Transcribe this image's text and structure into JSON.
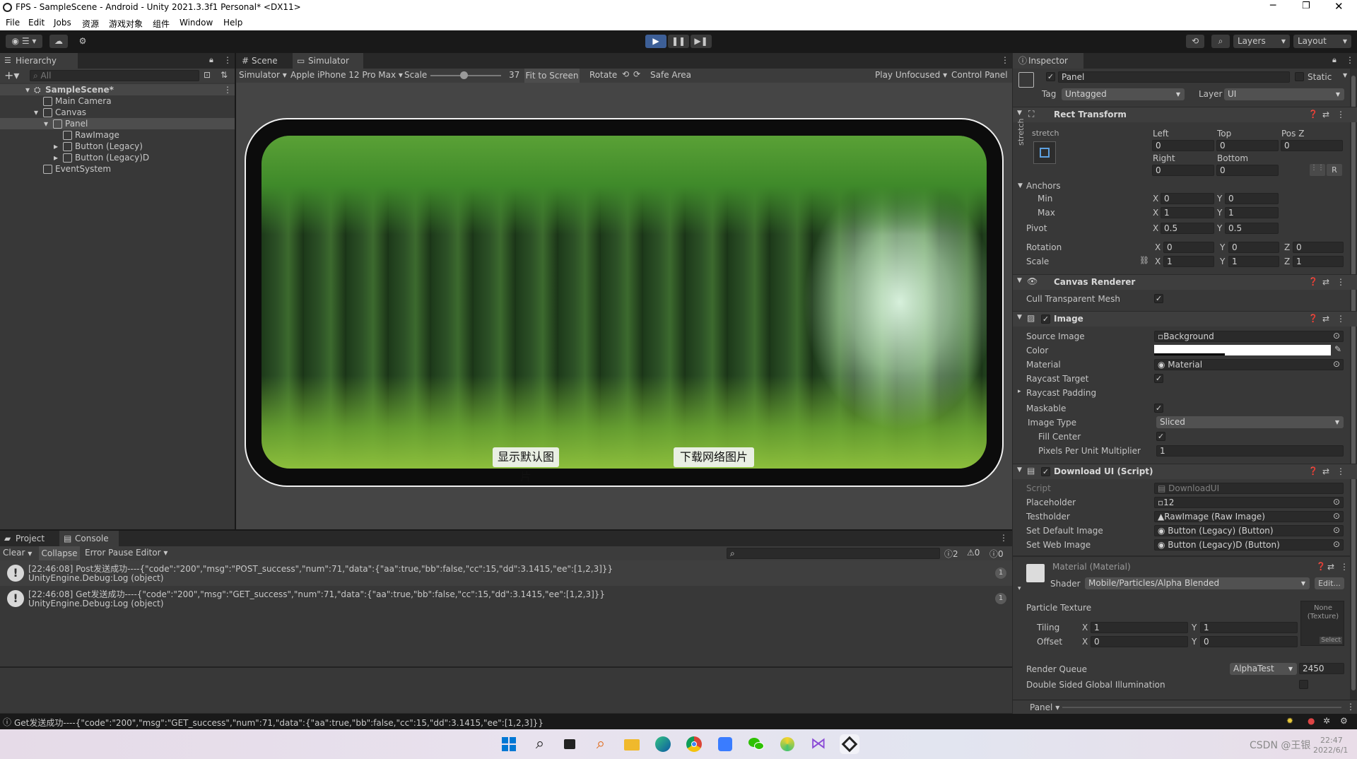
{
  "window": {
    "title": "FPS - SampleScene - Android - Unity 2021.3.3f1 Personal* <DX11>"
  },
  "menu": [
    "File",
    "Edit",
    "Jobs",
    "资源",
    "游戏对象",
    "组件",
    "Window",
    "Help"
  ],
  "toolbar": {
    "layers": "Layers",
    "layout": "Layout"
  },
  "hierarchy": {
    "tab": "Hierarchy",
    "search_placeholder": "All",
    "items": [
      {
        "label": "SampleScene*",
        "depth": 0
      },
      {
        "label": "Main Camera",
        "depth": 1
      },
      {
        "label": "Canvas",
        "depth": 1
      },
      {
        "label": "Panel",
        "depth": 2
      },
      {
        "label": "RawImage",
        "depth": 3
      },
      {
        "label": "Button (Legacy)",
        "depth": 3
      },
      {
        "label": "Button (Legacy)D",
        "depth": 3
      },
      {
        "label": "EventSystem",
        "depth": 1
      }
    ]
  },
  "scene_tabs": {
    "scene": "Scene",
    "simulator": "Simulator"
  },
  "sim_toolbar": {
    "mode": "Simulator",
    "device": "Apple iPhone 12 Pro Max",
    "scale_label": "Scale",
    "scale_value": "37",
    "fit": "Fit to Screen",
    "rotate": "Rotate",
    "safe_area": "Safe Area",
    "play_mode": "Play Unfocused",
    "control_panel": "Control Panel"
  },
  "game": {
    "button_default": "显示默认图片",
    "button_web": "下载网络图片"
  },
  "bottom_tabs": {
    "project": "Project",
    "console": "Console"
  },
  "console_toolbar": {
    "clear": "Clear",
    "collapse": "Collapse",
    "error_pause": "Error Pause",
    "editor": "Editor",
    "count_info": "2",
    "count_warn": "0",
    "count_err": "0"
  },
  "console_entries": [
    {
      "line1": "[22:46:08] Post发送成功----{\"code\":\"200\",\"msg\":\"POST_success\",\"num\":71,\"data\":{\"aa\":true,\"bb\":false,\"cc\":15,\"dd\":3.1415,\"ee\":[1,2,3]}}",
      "line2": "UnityEngine.Debug:Log (object)",
      "count": "1"
    },
    {
      "line1": "[22:46:08] Get发送成功----{\"code\":\"200\",\"msg\":\"GET_success\",\"num\":71,\"data\":{\"aa\":true,\"bb\":false,\"cc\":15,\"dd\":3.1415,\"ee\":[1,2,3]}}",
      "line2": "UnityEngine.Debug:Log (object)",
      "count": "1"
    }
  ],
  "status_bar": "Get发送成功----{\"code\":\"200\",\"msg\":\"GET_success\",\"num\":71,\"data\":{\"aa\":true,\"bb\":false,\"cc\":15,\"dd\":3.1415,\"ee\":[1,2,3]}}",
  "inspector": {
    "tab": "Inspector",
    "object_name": "Panel",
    "static": "Static",
    "tag_label": "Tag",
    "tag": "Untagged",
    "layer_label": "Layer",
    "layer": "UI",
    "rect": {
      "title": "Rect Transform",
      "stretch_top": "stretch",
      "stretch_side": "stretch",
      "left_lbl": "Left",
      "top_lbl": "Top",
      "posz_lbl": "Pos Z",
      "left": "0",
      "top": "0",
      "posz": "0",
      "right_lbl": "Right",
      "bottom_lbl": "Bottom",
      "right": "0",
      "bottom": "0",
      "r_btn": "R",
      "anchors": "Anchors",
      "min": "Min",
      "max": "Max",
      "pivot": "Pivot",
      "rotation": "Rotation",
      "scale": "Scale",
      "x": "X",
      "y": "Y",
      "z": "Z",
      "min_x": "0",
      "min_y": "0",
      "max_x": "1",
      "max_y": "1",
      "pivot_x": "0.5",
      "pivot_y": "0.5",
      "rot_x": "0",
      "rot_y": "0",
      "rot_z": "0",
      "scale_x": "1",
      "scale_y": "1",
      "scale_z": "1"
    },
    "canvas_renderer": {
      "title": "Canvas Renderer",
      "cull": "Cull Transparent Mesh"
    },
    "image": {
      "title": "Image",
      "source_lbl": "Source Image",
      "source": "Background",
      "color_lbl": "Color",
      "material_lbl": "Material",
      "material": "Material",
      "raycast_lbl": "Raycast Target",
      "padding_lbl": "Raycast Padding",
      "maskable_lbl": "Maskable",
      "type_lbl": "Image Type",
      "type": "Sliced",
      "fill_lbl": "Fill Center",
      "ppu_lbl": "Pixels Per Unit Multiplier",
      "ppu": "1"
    },
    "download": {
      "title": "Download UI (Script)",
      "script_lbl": "Script",
      "script": "DownloadUI",
      "placeholder_lbl": "Placeholder",
      "placeholder": "12",
      "testholder_lbl": "Testholder",
      "testholder": "RawImage (Raw Image)",
      "setdefault_lbl": "Set Default Image",
      "setdefault": "Button (Legacy) (Button)",
      "setweb_lbl": "Set Web Image",
      "setweb": "Button (Legacy)D (Button)"
    },
    "material": {
      "title": "Material (Material)",
      "shader_lbl": "Shader",
      "shader": "Mobile/Particles/Alpha Blended",
      "edit": "Edit...",
      "texture_lbl": "Particle Texture",
      "none": "None (Texture)",
      "select": "Select",
      "tiling": "Tiling",
      "offset": "Offset",
      "til_x": "1",
      "til_y": "1",
      "off_x": "0",
      "off_y": "0",
      "queue_lbl": "Render Queue",
      "queue_mode": "AlphaTest",
      "queue": "2450",
      "double": "Double Sided Global Illumination"
    },
    "footer": "Panel"
  },
  "taskbar": {
    "watermark": "CSDN @王银",
    "time": "22:47",
    "date": "2022/6/1"
  },
  "colors": {
    "accent": "#4a7bd1",
    "play_active": "#3d5f97"
  }
}
